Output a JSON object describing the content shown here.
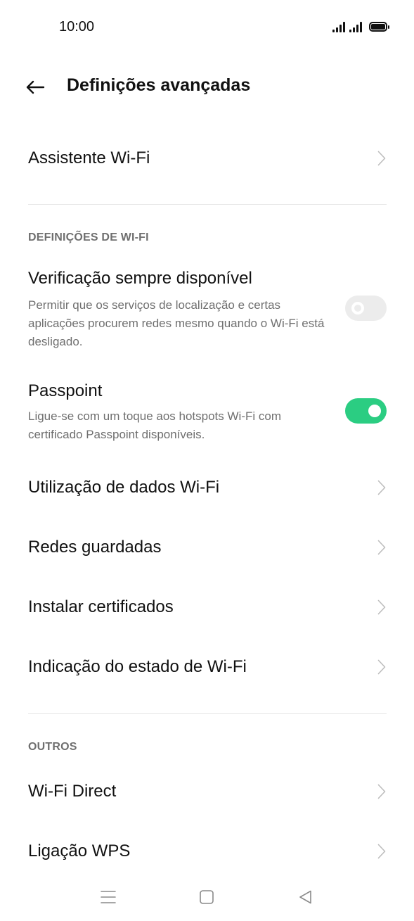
{
  "status_bar": {
    "time": "10:00",
    "icons": [
      "signal-icon",
      "signal-icon",
      "battery-icon"
    ]
  },
  "header": {
    "title": "Definições avançadas",
    "back_icon": "arrow-left-icon"
  },
  "items": {
    "assistant": {
      "label": "Assistente Wi-Fi"
    },
    "wifi_section_header": "DEFINIÇÕES DE WI-FI",
    "scanning": {
      "label": "Verificação sempre disponível",
      "description": "Permitir que os serviços de localização e certas aplicações procurem redes mesmo quando o Wi-Fi está desligado.",
      "enabled": false
    },
    "passpoint": {
      "label": "Passpoint",
      "description": "Ligue-se com um toque aos hotspots Wi-Fi com certificado Passpoint disponíveis.",
      "enabled": true
    },
    "data_usage": {
      "label": "Utilização de dados Wi-Fi"
    },
    "saved_networks": {
      "label": "Redes guardadas"
    },
    "install_certs": {
      "label": "Instalar certificados"
    },
    "status_indication": {
      "label": "Indicação do estado de Wi-Fi"
    },
    "others_section_header": "OUTROS",
    "wifi_direct": {
      "label": "Wi-Fi Direct"
    },
    "wps": {
      "label": "Ligação WPS"
    }
  },
  "nav_bar": {
    "icons": [
      "menu-icon",
      "home-icon",
      "back-triangle-icon"
    ]
  },
  "colors": {
    "accent": "#2bcd82",
    "toggle_off": "#ececec",
    "secondary_text": "#6f6f6f",
    "divider": "#e6e6e6"
  }
}
